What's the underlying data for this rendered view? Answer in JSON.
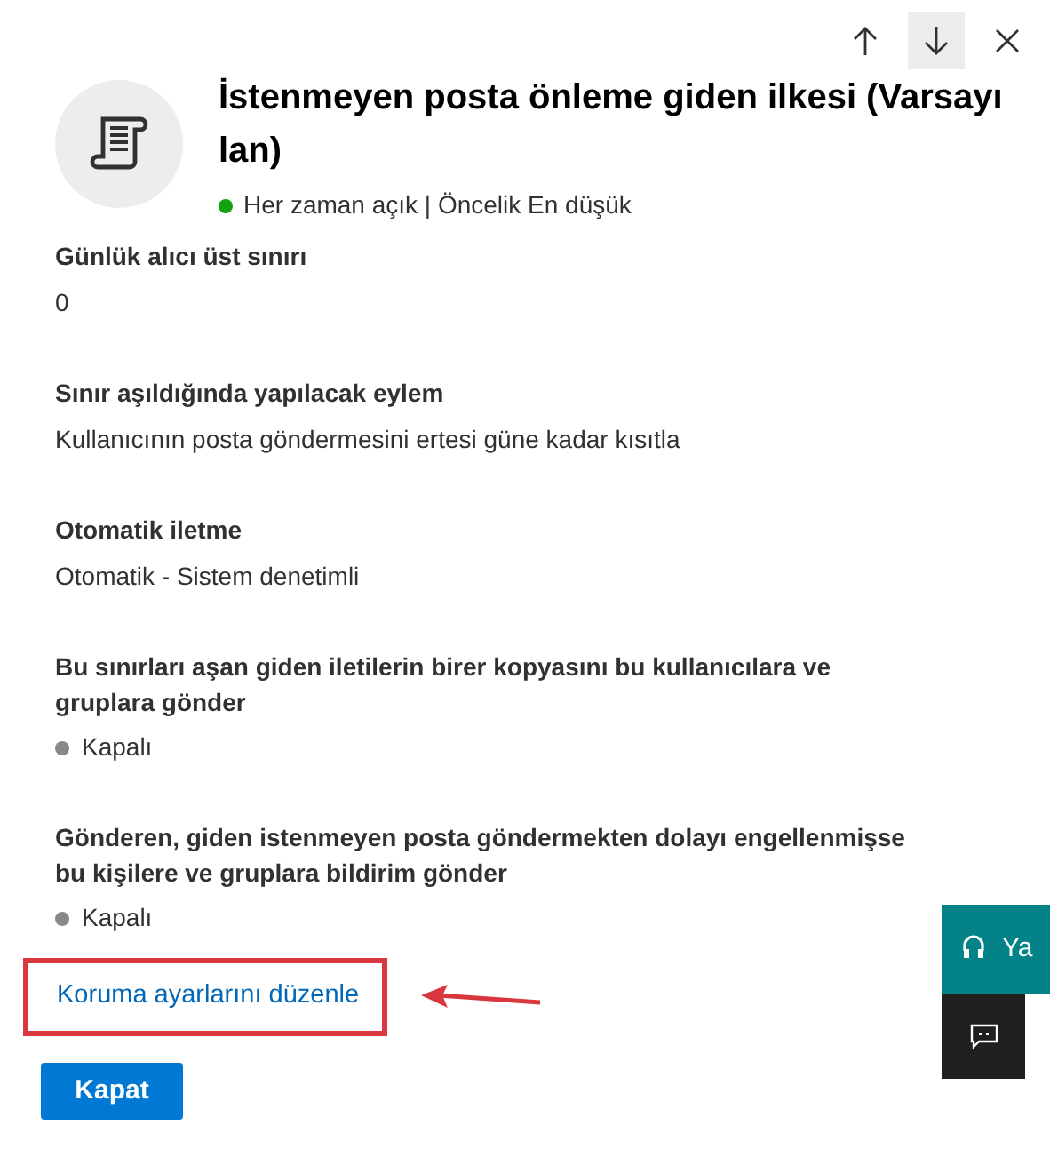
{
  "toolbar": [
    {
      "kind": "up",
      "hovered": false
    },
    {
      "kind": "down",
      "hovered": true
    },
    {
      "kind": "close",
      "hovered": false
    }
  ],
  "header": {
    "title": "İstenmeyen posta önleme giden ilkesi (Varsayılan)",
    "status": {
      "text": "Her zaman açık | Öncelik En düşük",
      "color": "#13a10e"
    }
  },
  "fields": [
    {
      "label": "Günlük alıcı üst sınırı",
      "kind": "text",
      "value": "0"
    },
    {
      "label": "Sınır aşıldığında yapılacak eylem",
      "kind": "text",
      "value": "Kullanıcının posta göndermesini ertesi güne kadar kısıtla"
    },
    {
      "label": "Otomatik iletme",
      "kind": "text",
      "value": "Otomatik - Sistem denetimli"
    },
    {
      "label": "Bu sınırları aşan giden iletilerin birer kopyasını bu kullanıcılara ve gruplara gönder",
      "kind": "status",
      "value": "Kapalı",
      "on": false
    },
    {
      "label": "Gönderen, giden istenmeyen posta göndermekten dolayı engellenmişse bu kişilere ve gruplara bildirim gönder",
      "kind": "status",
      "value": "Kapalı",
      "on": false
    }
  ],
  "edit_link": {
    "text": "Koruma ayarlarını düzenle",
    "highlighted": true
  },
  "close_button": "Kapat",
  "side_widgets": [
    {
      "kind": "help",
      "text": "Ya"
    },
    {
      "kind": "feedback"
    }
  ]
}
